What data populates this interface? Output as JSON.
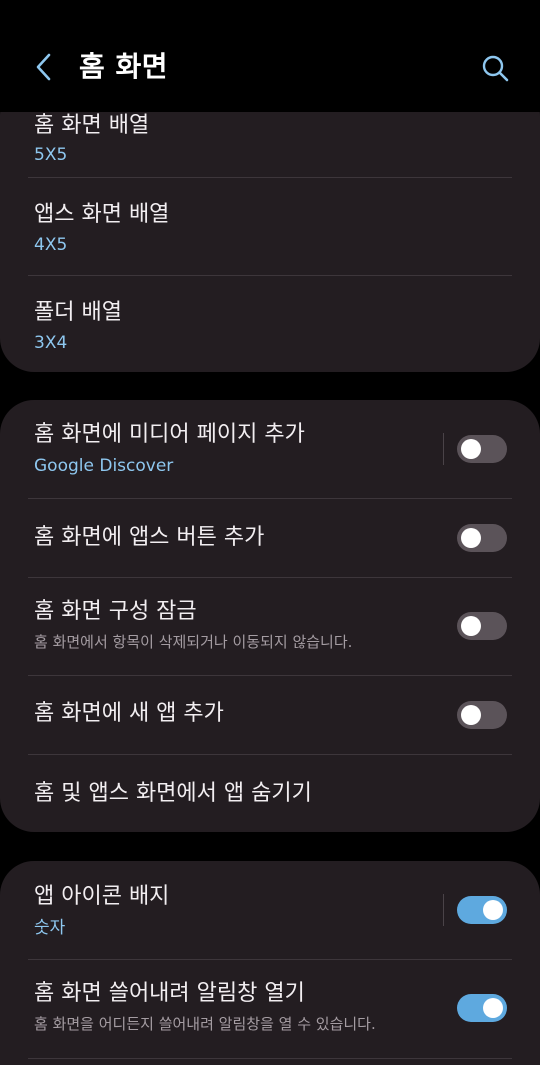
{
  "header": {
    "title": "홈 화면",
    "back_icon": "chevron-left-icon",
    "search_icon": "search-icon"
  },
  "colors": {
    "background": "#000000",
    "card": "#231d21",
    "accent": "#8ec7ef",
    "toggle_on": "#5ea9df",
    "toggle_off": "#5b5359"
  },
  "section1": {
    "items": [
      {
        "title": "홈 화면 배열",
        "value": "5X5"
      },
      {
        "title": "앱스 화면 배열",
        "value": "4X5"
      },
      {
        "title": "폴더 배열",
        "value": "3X4"
      }
    ]
  },
  "section2": {
    "media_page": {
      "title": "홈 화면에 미디어 페이지 추가",
      "value": "Google Discover",
      "enabled": false
    },
    "apps_button": {
      "title": "홈 화면에 앱스 버튼 추가",
      "enabled": false
    },
    "lock_layout": {
      "title": "홈 화면 구성 잠금",
      "description": "홈 화면에서 항목이 삭제되거나 이동되지 않습니다.",
      "enabled": false
    },
    "add_new_apps": {
      "title": "홈 화면에 새 앱 추가",
      "enabled": false
    },
    "hide_apps": {
      "title": "홈 및 앱스 화면에서 앱 숨기기"
    }
  },
  "section3": {
    "badges": {
      "title": "앱 아이콘 배지",
      "value": "숫자",
      "enabled": true
    },
    "swipe_down": {
      "title": "홈 화면 쓸어내려 알림창 열기",
      "description": "홈 화면을 어디든지 쓸어내려 알림창을 열 수 있습니다.",
      "enabled": true
    }
  }
}
